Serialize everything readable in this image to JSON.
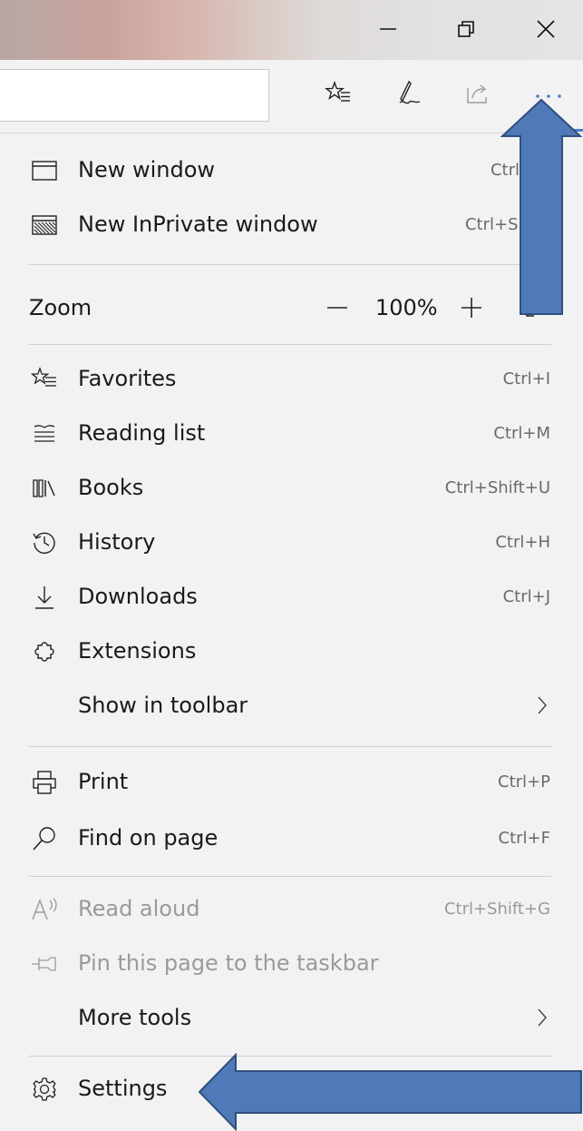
{
  "window_controls": {
    "minimize_icon": "minimize-icon",
    "restore_icon": "restore-icon",
    "close_icon": "close-icon"
  },
  "toolbar": {
    "address_value": "",
    "favorites_icon": "star-list-icon",
    "notes_icon": "pen-icon",
    "share_icon": "share-icon",
    "more_icon": "ellipsis-icon"
  },
  "menu": {
    "new_window": {
      "label": "New window",
      "shortcut": "Ctrl"
    },
    "new_inprivate": {
      "label": "New InPrivate window",
      "shortcut": "Ctrl+Shift"
    },
    "zoom": {
      "label": "Zoom",
      "value": "100%"
    },
    "favorites": {
      "label": "Favorites",
      "shortcut": "Ctrl+I"
    },
    "reading_list": {
      "label": "Reading list",
      "shortcut": "Ctrl+M"
    },
    "books": {
      "label": "Books",
      "shortcut": "Ctrl+Shift+U"
    },
    "history": {
      "label": "History",
      "shortcut": "Ctrl+H"
    },
    "downloads": {
      "label": "Downloads",
      "shortcut": "Ctrl+J"
    },
    "extensions": {
      "label": "Extensions"
    },
    "show_in_toolbar": {
      "label": "Show in toolbar"
    },
    "print": {
      "label": "Print",
      "shortcut": "Ctrl+P"
    },
    "find_on_page": {
      "label": "Find on page",
      "shortcut": "Ctrl+F"
    },
    "read_aloud": {
      "label": "Read aloud",
      "shortcut": "Ctrl+Shift+G"
    },
    "pin_taskbar": {
      "label": "Pin this page to the taskbar"
    },
    "more_tools": {
      "label": "More tools"
    },
    "settings": {
      "label": "Settings"
    }
  },
  "colors": {
    "accent": "#4a7fc7",
    "annotation_arrow": "#4f79b7",
    "menu_background": "#f2f2f2"
  }
}
